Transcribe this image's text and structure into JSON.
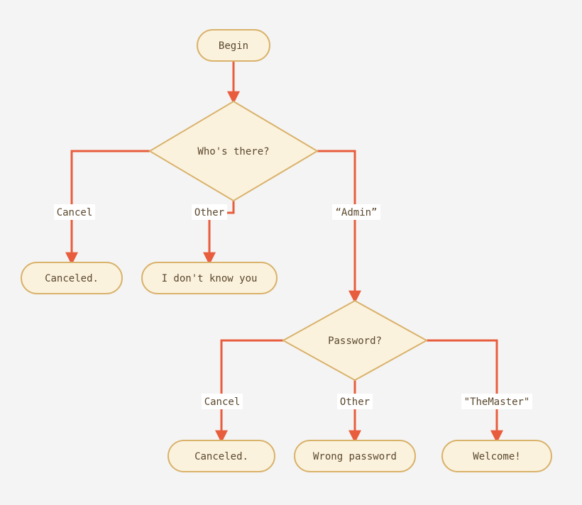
{
  "colors": {
    "node_fill": "#fbf2de",
    "node_stroke": "#d9b26a",
    "edge": "#e85d3d",
    "bg": "#f4f4f4",
    "text": "#5a472c"
  },
  "nodes": {
    "begin": {
      "type": "terminal",
      "label": "Begin"
    },
    "who": {
      "type": "decision",
      "label": "Who's there?"
    },
    "canceled1": {
      "type": "terminal",
      "label": "Canceled."
    },
    "idk": {
      "type": "terminal",
      "label": "I don't know you"
    },
    "password": {
      "type": "decision",
      "label": "Password?"
    },
    "canceled2": {
      "type": "terminal",
      "label": "Canceled."
    },
    "wrong": {
      "type": "terminal",
      "label": "Wrong password"
    },
    "welcome": {
      "type": "terminal",
      "label": "Welcome!"
    }
  },
  "edges": {
    "begin_who": {
      "from": "begin",
      "to": "who",
      "label": ""
    },
    "who_cancel": {
      "from": "who",
      "to": "canceled1",
      "label": "Cancel"
    },
    "who_other": {
      "from": "who",
      "to": "idk",
      "label": "Other"
    },
    "who_admin": {
      "from": "who",
      "to": "password",
      "label": "“Admin”"
    },
    "pw_cancel": {
      "from": "password",
      "to": "canceled2",
      "label": "Cancel"
    },
    "pw_other": {
      "from": "password",
      "to": "wrong",
      "label": "Other"
    },
    "pw_master": {
      "from": "password",
      "to": "welcome",
      "label": "\"TheMaster\""
    }
  }
}
